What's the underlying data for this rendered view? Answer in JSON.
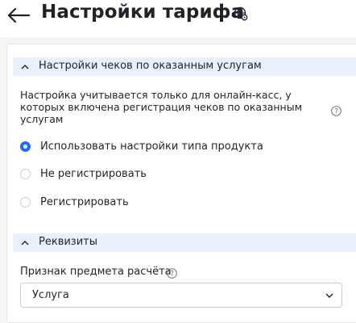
{
  "header": {
    "title": "Настройки тарифа"
  },
  "receipts_section": {
    "title": "Настройки чеков по оказанным услугам",
    "description": "Настройка учитывается только для онлайн-касс, у которых включена регистрация чеков по оказанным услугам",
    "options": [
      {
        "label": "Использовать настройки типа продукта",
        "checked": true
      },
      {
        "label": "Не регистрировать",
        "checked": false
      },
      {
        "label": "Регистрировать",
        "checked": false
      }
    ]
  },
  "requisites_section": {
    "title": "Реквизиты",
    "payment_subject_label": "Признак предмета расчёта",
    "payment_subject_value": "Услуга"
  },
  "colors": {
    "accent": "#1e6fe8",
    "section_bg": "#e9f0fb",
    "text": "#1f2329"
  }
}
